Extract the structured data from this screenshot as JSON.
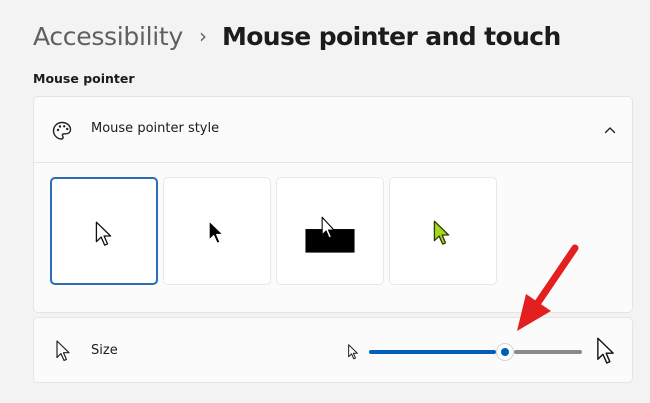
{
  "breadcrumb": {
    "parent": "Accessibility",
    "separator": "›",
    "current": "Mouse pointer and touch"
  },
  "section": {
    "title": "Mouse pointer"
  },
  "pointer_style": {
    "label": "Mouse pointer style",
    "expanded": true,
    "options": [
      {
        "name": "white",
        "selected": true
      },
      {
        "name": "black",
        "selected": false
      },
      {
        "name": "inverted",
        "selected": false
      },
      {
        "name": "custom-lime",
        "selected": false
      }
    ]
  },
  "size": {
    "label": "Size",
    "value_fraction": 0.64
  },
  "colors": {
    "accent": "#005fb8",
    "selected_border": "#2c6db6",
    "custom_pointer": "#a8d81b",
    "annotation": "#e41f1f"
  }
}
